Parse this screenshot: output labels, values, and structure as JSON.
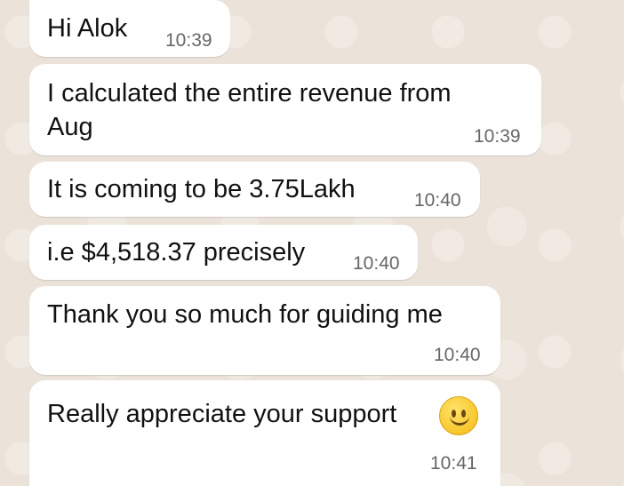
{
  "messages": [
    {
      "text": "Hi Alok",
      "time": "10:39"
    },
    {
      "text": "I calculated the entire revenue from\nAug",
      "time": "10:39"
    },
    {
      "text": "It is coming to be 3.75Lakh",
      "time": "10:40"
    },
    {
      "text": "i.e $4,518.37 precisely",
      "time": "10:40"
    },
    {
      "text": "Thank you so much for guiding me",
      "time": "10:40"
    },
    {
      "text": "Really appreciate your support",
      "time": "10:41",
      "emoji": "slightly-smiling-face-icon"
    }
  ],
  "colors": {
    "bubble": "#ffffff",
    "background": "#ebe3da",
    "text": "#111111",
    "time": "#666666"
  }
}
